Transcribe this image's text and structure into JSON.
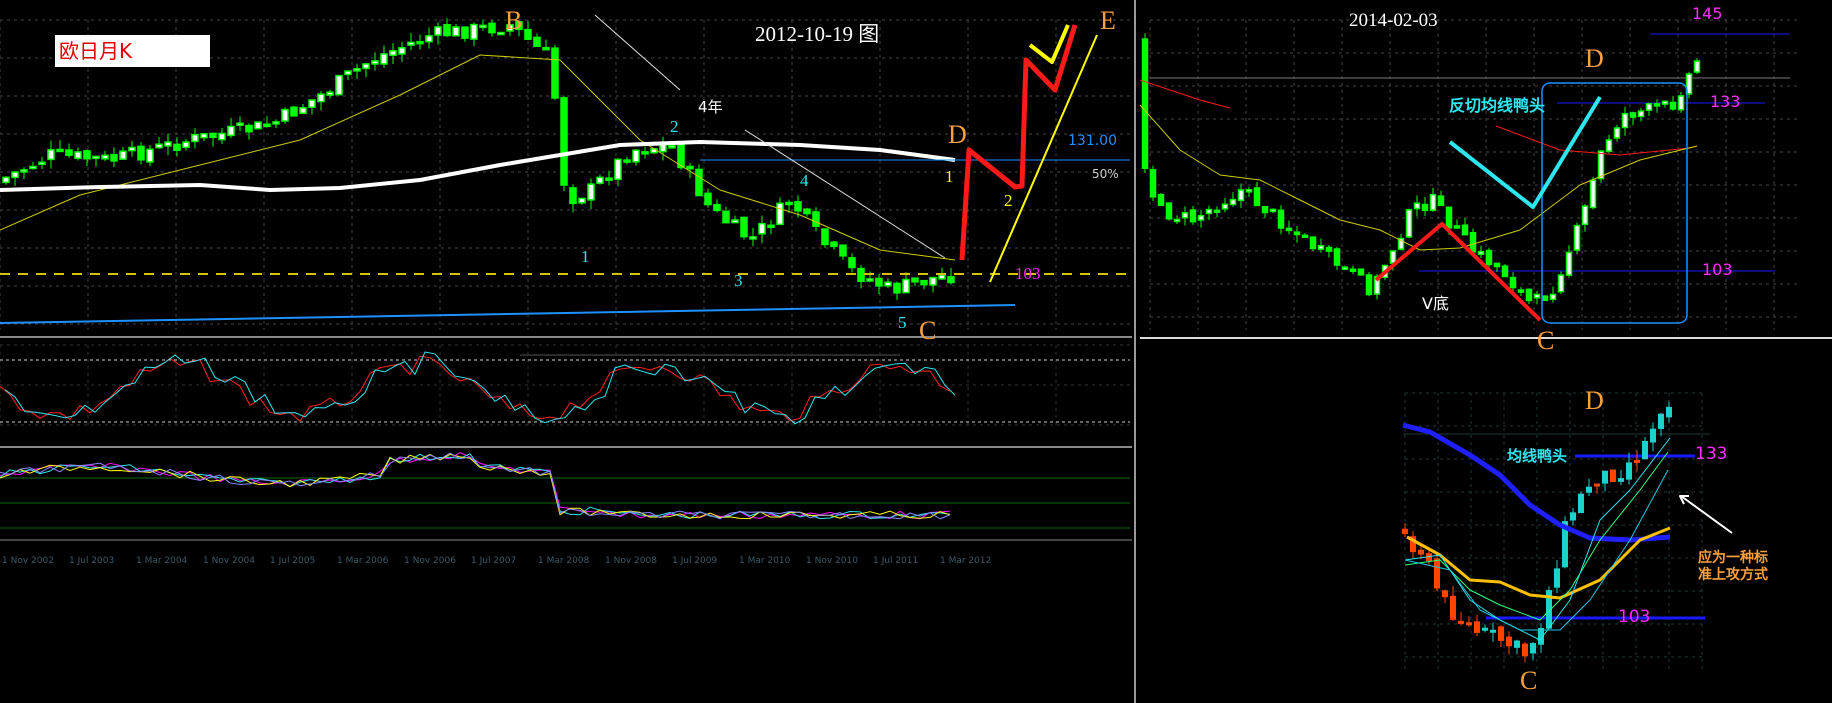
{
  "left_chart": {
    "symbol_label": "欧日月K",
    "date_title": "2012-10-19  图",
    "wave_labels": {
      "B": "B",
      "C": "C",
      "D": "D",
      "E": "E",
      "w1": "1",
      "w2": "2",
      "w3": "3",
      "w4": "4",
      "w5": "5",
      "d1": "1",
      "d2": "2"
    },
    "span_label": "4年",
    "level_131": "131.00",
    "pct_label": "50%",
    "level_103": "103",
    "date_axis": [
      "1 Nov 2002",
      "1 Jul 2003",
      "1 Mar 2004",
      "1 Nov 2004",
      "1 Jul 2005",
      "1 Mar 2006",
      "1 Nov 2006",
      "1 Jul 2007",
      "1 Mar 2008",
      "1 Nov 2008",
      "1 Jul 2009",
      "1 Mar 2010",
      "1 Nov 2010",
      "1 Jul 2011",
      "1 Mar 2012"
    ]
  },
  "right_top_chart": {
    "date_title": "2014-02-03",
    "label_D": "D",
    "label_C": "C",
    "level_145": "145",
    "level_133": "133",
    "level_103": "103",
    "pattern_label": "反切均线鸭头",
    "v_bottom_label": "V底"
  },
  "right_bottom_chart": {
    "label_D": "D",
    "label_C": "C",
    "level_133": "133",
    "level_103": "103",
    "pattern_label": "均线鸭头",
    "note_line1": "应为一种标",
    "note_line2": "准上攻方式"
  },
  "colors": {
    "bull": "#00ff00",
    "bear": "#ff3300",
    "cyan": "#2ee6f0",
    "magenta": "#ff2bff",
    "orange": "#f7a040",
    "blue": "#1a1aff"
  }
}
